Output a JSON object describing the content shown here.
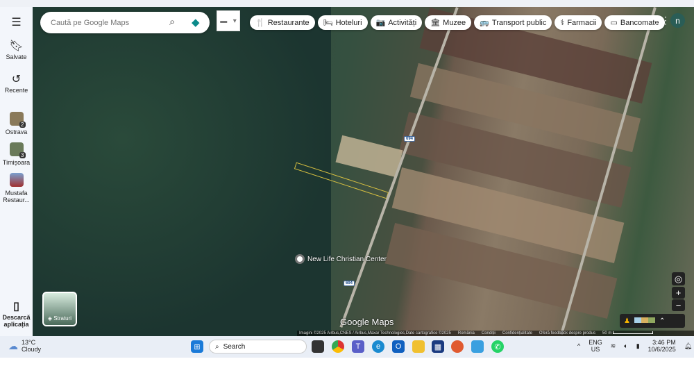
{
  "search": {
    "placeholder": "Caută pe Google Maps"
  },
  "sidebar": {
    "saved": "Salvate",
    "recent": "Recente",
    "recents": [
      {
        "label": "Ostrava",
        "badge": "2"
      },
      {
        "label": "Timișoara",
        "badge": "3"
      },
      {
        "label": "Mustafa Restaur..."
      }
    ],
    "download": "Descarcă aplicația"
  },
  "chips": [
    "Restaurante",
    "Hoteluri",
    "Activități",
    "Muzee",
    "Transport public",
    "Farmacii",
    "Bancomate"
  ],
  "chip_icons": [
    "🍴",
    "🛏",
    "📷",
    "🏛",
    "🚌",
    "⚕",
    "▭"
  ],
  "avatar": "n",
  "map": {
    "road_shield": "694",
    "place": "New Life Christian Center",
    "layers": "Straturi",
    "logo": "Google Maps"
  },
  "attribution": {
    "imagery": "Imagini ©2025 Airbus,CNES / Airbus,Maxar Technologies,Date cartografice ©2025",
    "country": "România",
    "terms": "Condiții",
    "privacy": "Confidențialitate",
    "feedback": "Oferă feedback despre produs",
    "scale": "50 m"
  },
  "taskbar": {
    "temp": "13°C",
    "condition": "Cloudy",
    "search": "Search",
    "lang": "ENG",
    "region": "US",
    "time": "3:46 PM",
    "date": "10/6/2025"
  }
}
